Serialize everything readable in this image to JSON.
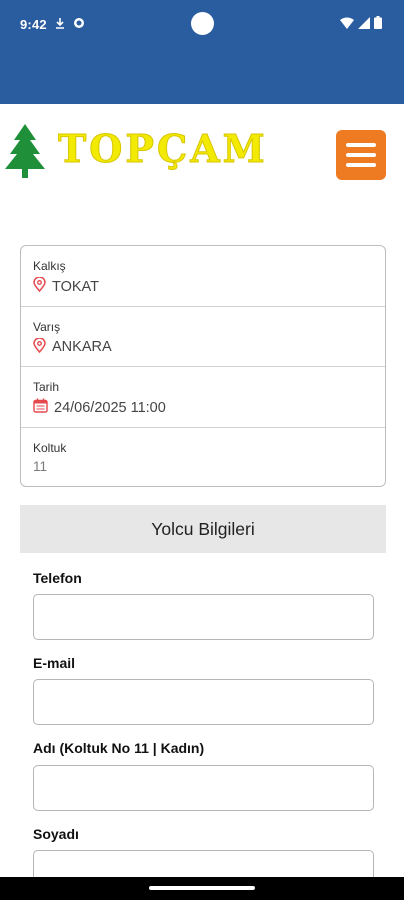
{
  "status_bar": {
    "time": "9:42",
    "icons": [
      "download-icon",
      "sync-icon",
      "wifi-icon",
      "signal-icon",
      "battery-icon"
    ]
  },
  "header": {
    "logo_text": "TOPÇAM",
    "logo_icon": "pine-tree-icon",
    "menu_icon": "hamburger-menu-icon",
    "colors": {
      "app_bar": "#2a5d9f",
      "logo_text": "#f2ea00",
      "tree": "#1f8f3a",
      "menu_button": "#ee7a22"
    }
  },
  "trip": {
    "departure_label": "Kalkış",
    "departure_value": "TOKAT",
    "arrival_label": "Varış",
    "arrival_value": "ANKARA",
    "date_label": "Tarih",
    "date_value": "24/06/2025 11:00",
    "seat_label": "Koltuk",
    "seat_value": "11",
    "icon_color": "#e5484d"
  },
  "section": {
    "title": "Yolcu Bilgileri"
  },
  "form": {
    "phone_label": "Telefon",
    "phone_value": "",
    "email_label": "E-mail",
    "email_value": "",
    "firstname_label": "Adı (Koltuk No 11 | Kadın)",
    "firstname_value": "",
    "lastname_label": "Soyadı",
    "lastname_value": ""
  }
}
